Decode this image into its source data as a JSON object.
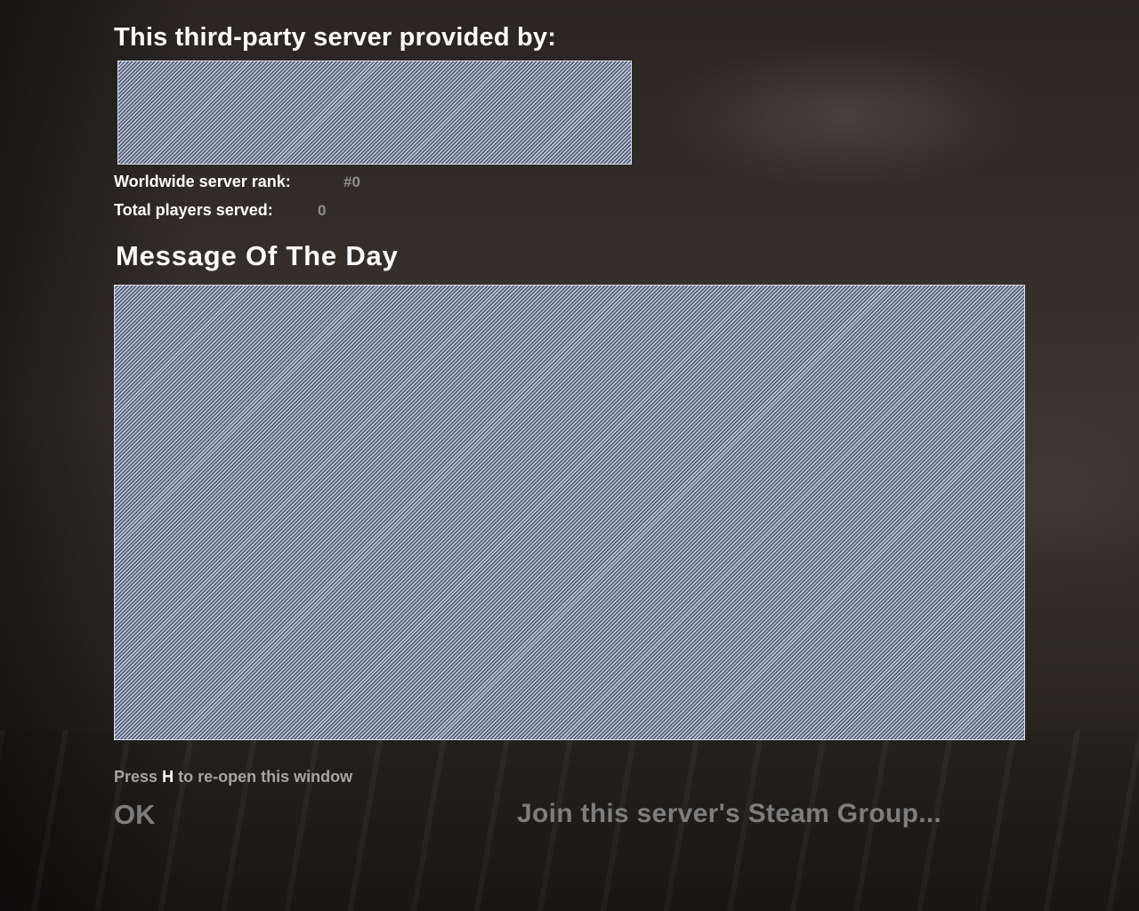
{
  "header": {
    "title": "This third-party server provided by:"
  },
  "stats": {
    "rank_label": "Worldwide server rank:",
    "rank_value": "#0",
    "players_label": "Total players served:",
    "players_value": "0"
  },
  "motd": {
    "heading": "Message Of The Day"
  },
  "footer": {
    "hint_press": "Press",
    "hint_key": "H",
    "hint_rest": "to re-open this window",
    "ok_label": "OK",
    "steam_label": "Join this server's Steam Group..."
  }
}
